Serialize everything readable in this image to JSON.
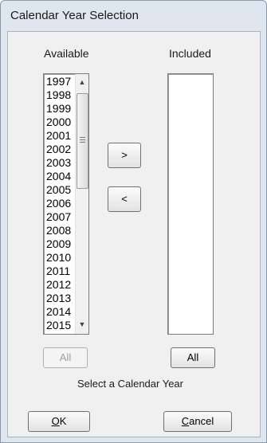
{
  "window": {
    "title": "Calendar Year Selection"
  },
  "available": {
    "header": "Available",
    "items": [
      "1997",
      "1998",
      "1999",
      "2000",
      "2001",
      "2002",
      "2003",
      "2004",
      "2005",
      "2006",
      "2007",
      "2008",
      "2009",
      "2010",
      "2011",
      "2012",
      "2013",
      "2014",
      "2015"
    ],
    "all_label": "All",
    "scroll_up": "▲",
    "scroll_down": "▼"
  },
  "included": {
    "header": "Included",
    "items": [],
    "all_label": "All"
  },
  "move": {
    "add_label": ">",
    "remove_label": "<"
  },
  "status": "Select a Calendar Year",
  "footer": {
    "ok_mnemonic": "O",
    "ok_rest": "K",
    "cancel_mnemonic": "C",
    "cancel_rest": "ancel"
  }
}
